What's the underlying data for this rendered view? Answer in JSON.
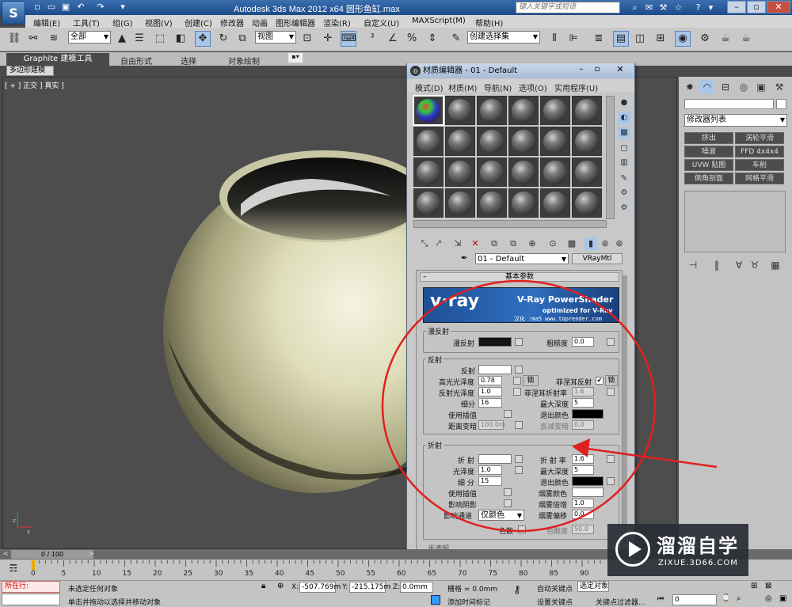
{
  "titlebar": {
    "title": "Autodesk 3ds Max  2012 x64       圆形鱼缸.max",
    "search_placeholder": "键入关键字或短语"
  },
  "menu": [
    "编辑(E)",
    "工具(T)",
    "组(G)",
    "视图(V)",
    "创建(C)",
    "修改器",
    "动画",
    "图形编辑器",
    "渲染(R)",
    "自定义(U)",
    "MAXScript(M)",
    "帮助(H)"
  ],
  "toolbar": {
    "selection_filter": "全部",
    "ref_coord": "视图",
    "named_selection": "创建选择集"
  },
  "ribbon": {
    "tabs": [
      "Graphite 建模工具",
      "自由形式",
      "选择",
      "对象绘制"
    ],
    "subtab": "多边形建模"
  },
  "viewport": {
    "label": "[ + ] 正交 ] 真实 ]"
  },
  "command_panel": {
    "modifier_list": "修改器列表",
    "modifiers": [
      "挤出",
      "涡轮平滑",
      "噪波",
      "FFD 4x4x4",
      "UVW 贴图",
      "车削",
      "倒角剖面",
      "网格平滑"
    ]
  },
  "material_editor": {
    "title": "材质编辑器 - 01 - Default",
    "menu": [
      "模式(D)",
      "材质(M)",
      "导航(N)",
      "选项(O)",
      "实用程序(U)"
    ],
    "material_name": "01 - Default",
    "material_type": "VRayMtl",
    "rollout_title": "基本参数",
    "banner": {
      "logo": "v·ray",
      "title": "V-Ray PowerShader",
      "subtitle": "optimized for V-Ray",
      "credit": "汉化 :ma5 www.toprender.com"
    },
    "diffuse": {
      "group": "漫反射",
      "diffuse_label": "漫反射",
      "roughness_label": "粗糙度",
      "roughness_value": "0.0"
    },
    "reflection": {
      "group": "反射",
      "reflect_label": "反射",
      "hilight_gloss_label": "高光光泽度",
      "hilight_gloss_value": "0.78",
      "lock_label": "锁",
      "fresnel_label": "菲涅耳反射",
      "fresnel_lock_label": "锁",
      "refl_gloss_label": "反射光泽度",
      "refl_gloss_value": "1.0",
      "fresnel_ior_label": "菲涅耳折射率",
      "fresnel_ior_value": "1.6",
      "subdivs_label": "细分",
      "subdivs_value": "16",
      "max_depth_label": "最大深度",
      "max_depth_value": "5",
      "use_interp_label": "使用插值",
      "exit_color_label": "退出颜色",
      "dim_distance_label": "距离变暗",
      "dim_distance_value": "100.0m",
      "dim_falloff_label": "衰减变暗",
      "dim_falloff_value": "0.0"
    },
    "refraction": {
      "group": "折射",
      "refract_label": "折 射",
      "ior_label": "折 射 率",
      "ior_value": "1.6",
      "gloss_label": "光泽度",
      "gloss_value": "1.0",
      "max_depth_label": "最大深度",
      "max_depth_value": "5",
      "subdivs_label": "细 分",
      "subdivs_value": "15",
      "exit_color_label": "退出颜色",
      "use_interp_label": "使用插值",
      "fog_color_label": "烟雾颜色",
      "affect_shadows_label": "影响阴影",
      "fog_mult_label": "烟雾倍增",
      "fog_mult_value": "1.0",
      "affect_channels_label": "影响通道",
      "affect_channels_value": "仅颜色",
      "fog_bias_label": "烟雾偏移",
      "fog_bias_value": "0.0",
      "dispersion_label": "色散",
      "abbe_label": "色散度",
      "abbe_value": "50.0"
    },
    "next_rollout": "半透明"
  },
  "timeline": {
    "frame": "0 / 100",
    "ticks": [
      "0",
      "5",
      "10",
      "15",
      "20",
      "25",
      "30",
      "35",
      "40",
      "45",
      "50",
      "55",
      "60",
      "65",
      "70",
      "75",
      "80",
      "85",
      "90"
    ]
  },
  "status": {
    "running": "所在行:",
    "selection": "未选定任何对象",
    "prompt": "单击并拖动以选择并移动对象",
    "x_label": "X:",
    "x_value": "-507.769m",
    "y_label": "Y:",
    "y_value": "-215.175m",
    "z_label": "Z:",
    "z_value": "0.0mm",
    "grid": "栅格 = 0.0mm",
    "add_time_tag": "添加时间标记",
    "auto_key": "自动关键点",
    "selected": "选定对象",
    "set_key": "设置关键点",
    "key_filters": "关键点过滤器...",
    "frame_value": "0"
  },
  "watermark": {
    "brand": "溜溜自学",
    "url": "ZIXUE.3D66.COM"
  },
  "colors": {
    "annotation": "#e02020",
    "vray_banner": "#1e4f94"
  }
}
